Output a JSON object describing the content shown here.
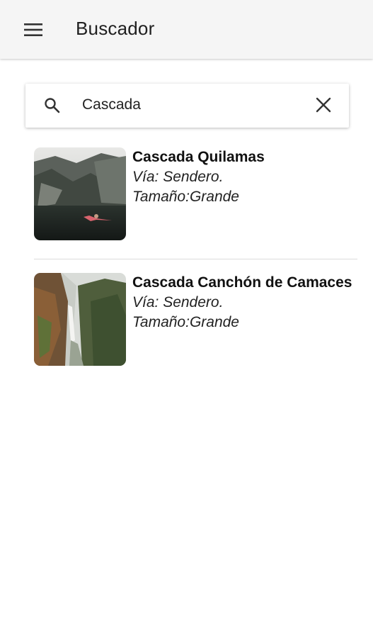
{
  "app": {
    "title": "Buscador",
    "menu_icon": "hamburger-menu-icon"
  },
  "search": {
    "value": "Cascada",
    "search_icon": "search-icon",
    "clear_icon": "close-icon"
  },
  "results": [
    {
      "title": "Cascada Quilamas",
      "via": "Vía: Sendero.",
      "size": "Tamaño:Grande"
    },
    {
      "title": "Cascada Canchón de Camaces",
      "via": "Vía: Sendero.",
      "size": "Tamaño:Grande"
    }
  ]
}
